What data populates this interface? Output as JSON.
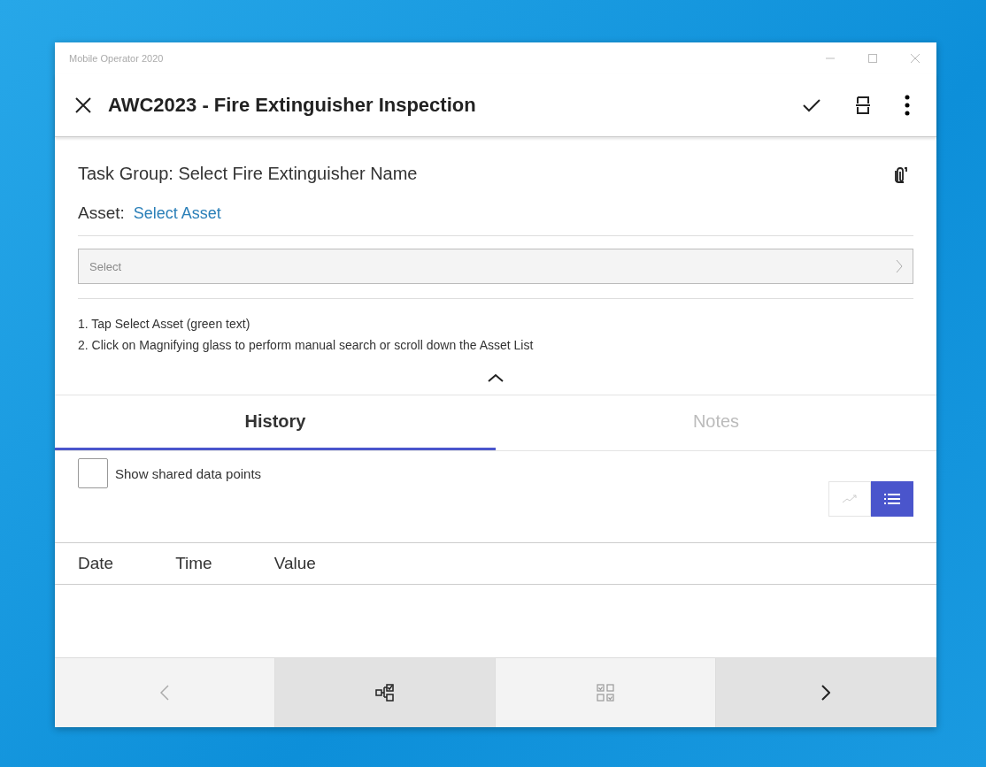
{
  "window": {
    "title": "Mobile Operator 2020"
  },
  "header": {
    "title": "AWC2023 - Fire Extinguisher Inspection"
  },
  "task_group": "Task Group: Select Fire Extinguisher Name",
  "asset": {
    "label": "Asset:",
    "link": "Select Asset"
  },
  "asset_select": {
    "placeholder": "Select"
  },
  "instructions": [
    "1. Tap Select Asset (green text)",
    "2. Click on Magnifying glass to perform manual search or scroll down the Asset List"
  ],
  "tabs": [
    {
      "label": "History",
      "selected": true
    },
    {
      "label": "Notes",
      "selected": false
    }
  ],
  "shared_points": {
    "label": "Show shared data points",
    "checked": false
  },
  "view_toggle": [
    {
      "kind": "chart",
      "selected": false
    },
    {
      "kind": "list",
      "selected": true
    }
  ],
  "columns": [
    "Date",
    "Time",
    "Value"
  ],
  "nav": [
    {
      "kind": "prev",
      "disabled": true
    },
    {
      "kind": "tree",
      "disabled": false
    },
    {
      "kind": "grid",
      "disabled": true
    },
    {
      "kind": "next",
      "disabled": false
    }
  ]
}
